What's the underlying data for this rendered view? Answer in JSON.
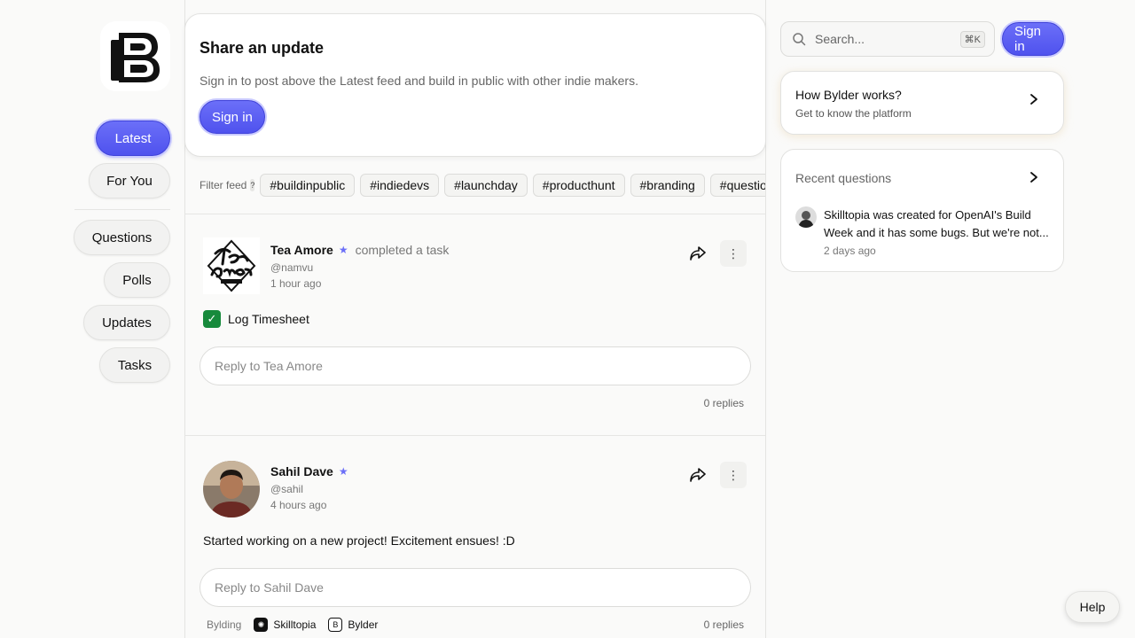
{
  "nav": {
    "items": [
      {
        "label": "Latest",
        "active": true
      },
      {
        "label": "For You"
      },
      {
        "label": "Questions"
      },
      {
        "label": "Polls"
      },
      {
        "label": "Updates"
      },
      {
        "label": "Tasks"
      }
    ]
  },
  "share": {
    "title": "Share an update",
    "subtitle": "Sign in to post above the Latest feed and build in public with other indie makers.",
    "signin_label": "Sign in"
  },
  "filter": {
    "label": "Filter feed",
    "help": "?",
    "tags": [
      "#buildinpublic",
      "#indiedevs",
      "#launchday",
      "#producthunt",
      "#branding",
      "#questions"
    ]
  },
  "posts": [
    {
      "author": "Tea Amore",
      "action": "completed a task",
      "handle": "@namvu",
      "time": "1 hour ago",
      "task": "Log Timesheet",
      "reply_placeholder": "Reply to Tea Amore",
      "replies": "0 replies"
    },
    {
      "author": "Sahil Dave",
      "handle": "@sahil",
      "time": "4 hours ago",
      "text": "Started working on a new project! Excitement ensues! :D",
      "reply_placeholder": "Reply to Sahil Dave",
      "replies": "0 replies",
      "bylding_label": "Bylding",
      "projects": [
        "Skilltopia",
        "Bylder"
      ]
    }
  ],
  "search": {
    "placeholder": "Search...",
    "shortcut": "⌘K"
  },
  "header": {
    "signin_label": "Sign in"
  },
  "how": {
    "title": "How Bylder works?",
    "subtitle": "Get to know the platform"
  },
  "recent": {
    "title": "Recent questions",
    "item_text": "Skilltopia was created for OpenAI's Build Week and it has some bugs. But we're not...",
    "item_time": "2 days ago"
  },
  "help": {
    "label": "Help"
  },
  "colors": {
    "accent": "#5558f2",
    "task_check": "#178a3c"
  }
}
